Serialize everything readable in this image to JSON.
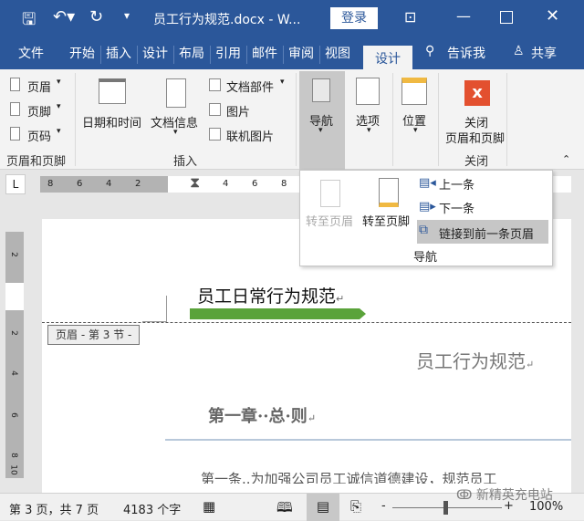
{
  "title_bar": {
    "doc_title": "员工行为规范.docx - W...",
    "login": "登录",
    "icons": [
      "save-icon",
      "undo-icon",
      "redo-icon",
      "customize-icon",
      "ribbon-display-icon",
      "minimize-icon",
      "maximize-icon",
      "close-icon"
    ]
  },
  "tabs": [
    {
      "label": "文件"
    },
    {
      "label": "开始"
    },
    {
      "label": "插入"
    },
    {
      "label": "设计"
    },
    {
      "label": "布局"
    },
    {
      "label": "引用"
    },
    {
      "label": "邮件"
    },
    {
      "label": "审阅"
    },
    {
      "label": "视图"
    },
    {
      "label": "设计",
      "active": true
    }
  ],
  "tell_me": "告诉我",
  "share": "共享",
  "ribbon": {
    "header_footer": {
      "header": "页眉",
      "footer": "页脚",
      "page_number": "页码",
      "group": "页眉和页脚"
    },
    "insert": {
      "date_time": "日期和时间",
      "doc_info": "文档信息",
      "quick_parts": "文档部件",
      "picture": "图片",
      "online_picture": "联机图片",
      "group": "插入"
    },
    "navigation": "导航",
    "options": "选项",
    "position": "位置",
    "close": {
      "label_1": "关闭",
      "label_2": "页眉和页脚",
      "group": "关闭"
    }
  },
  "popup": {
    "goto_header": "转至页眉",
    "goto_footer": "转至页脚",
    "previous": "上一条",
    "next": "下一条",
    "link_previous": "链接到前一条页眉",
    "group": "导航"
  },
  "ruler": {
    "left_ticks": [
      "8",
      "6",
      "4",
      "2"
    ],
    "right_ticks": [
      "4",
      "6",
      "8"
    ],
    "vertical_ticks": [
      "2",
      "2",
      "4",
      "6",
      "8",
      "10"
    ],
    "tab_selector": "L"
  },
  "document": {
    "header_title": "员工日常行为规范",
    "header_tag": "页眉 - 第 3 节 -",
    "doc_title": "员工行为规范",
    "chapter": "第一章··总·则",
    "body_line": "第一条..为加强公司员工诚信道德建设，规范员工",
    "mark": "↵"
  },
  "status": {
    "page": "第 3 页，共 7 页",
    "words": "4183 个字",
    "zoom": "100%",
    "zoom_minus": "-",
    "zoom_plus": "+"
  },
  "watermark": "新精英充电站",
  "colors": {
    "brand": "#2b579a",
    "accent_bar": "#5aa33a",
    "close_red": "#e3502f"
  }
}
